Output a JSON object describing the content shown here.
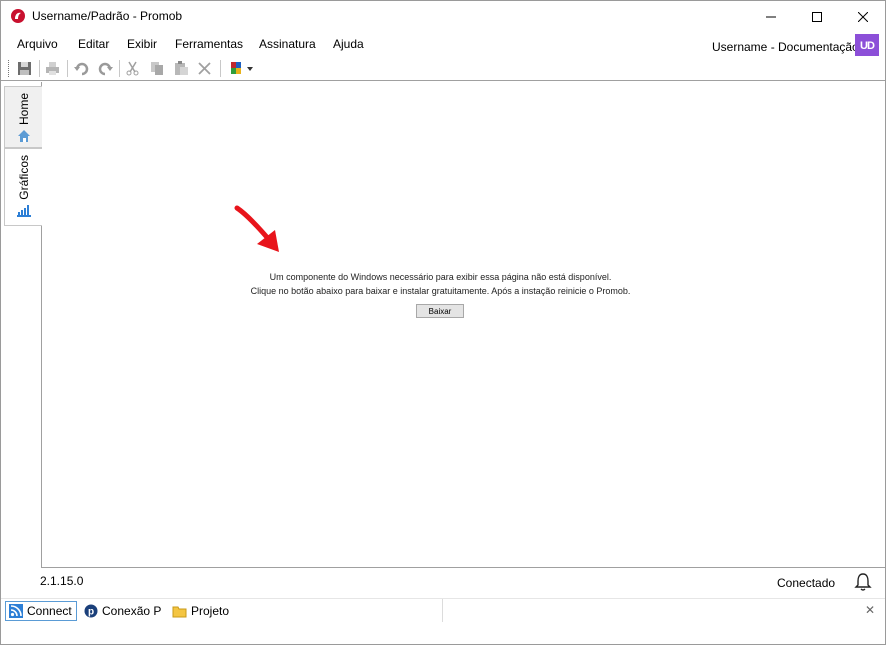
{
  "window": {
    "title": "Username/Padrão - Promob",
    "minimize_glyph": "—",
    "maximize_glyph": "□",
    "close_glyph": "✕"
  },
  "menu": {
    "items": [
      "Arquivo",
      "Editar",
      "Exibir",
      "Ferramentas",
      "Assinatura",
      "Ajuda"
    ],
    "user_label": "Username - Documentação",
    "avatar_initials": "UD",
    "avatar_color": "#8c4fd8"
  },
  "toolbar": {
    "icons": [
      "save-icon",
      "print-icon",
      "undo-icon",
      "redo-icon",
      "cut-icon",
      "copy-icon",
      "paste-icon",
      "delete-icon",
      "palette-icon"
    ]
  },
  "sidetabs": {
    "home_label": "Home",
    "graficos_label": "Gráficos"
  },
  "content": {
    "message_line1": "Um componente do Windows necessário para exibir essa página não está disponível.",
    "message_line2": "Clique no botão abaixo para baixar e instalar gratuitamente. Após a instação reinicie o Promob.",
    "download_button": "Baixar",
    "arrow_color": "#e8141b"
  },
  "status": {
    "version": "2.1.15.0",
    "connection": "Conectado"
  },
  "bottombar": {
    "tabs": [
      "Connect",
      "Conexão P",
      "Projeto"
    ],
    "close_glyph": "✕"
  }
}
